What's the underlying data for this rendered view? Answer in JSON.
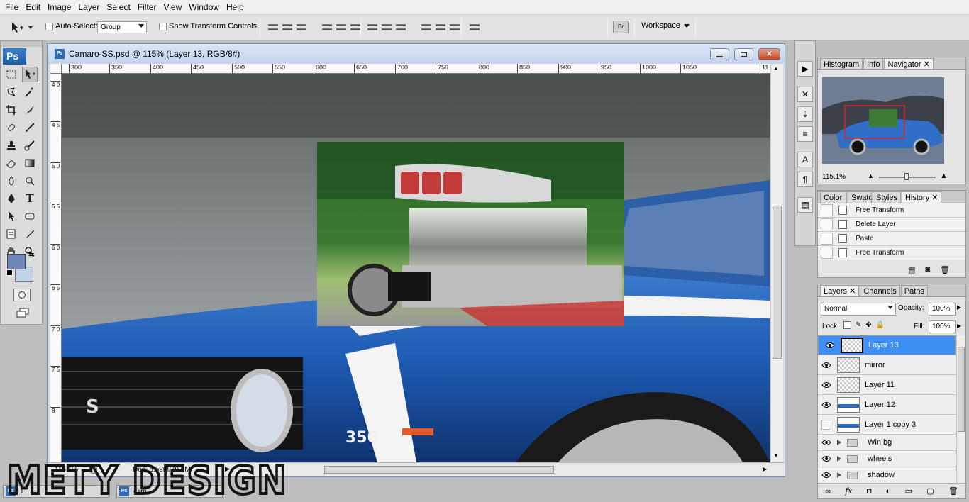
{
  "menubar": [
    "File",
    "Edit",
    "Image",
    "Layer",
    "Select",
    "Filter",
    "View",
    "Window",
    "Help"
  ],
  "options": {
    "auto_select_label": "Auto-Select:",
    "auto_select_value": "Group",
    "show_transform_label": "Show Transform Controls",
    "workspace_label": "Workspace"
  },
  "tools": {
    "badge": "Ps"
  },
  "document": {
    "title": "Camaro-SS.psd @ 115% (Layer 13, RGB/8#)",
    "ruler_top": [
      "300",
      "350",
      "400",
      "450",
      "500",
      "550",
      "600",
      "650",
      "700",
      "750",
      "800",
      "850",
      "900",
      "950",
      "1000",
      "1050",
      "11"
    ],
    "ruler_left": [
      "4 0",
      "4 5",
      "5 0",
      "5 5",
      "6 0",
      "6 5",
      "7 0",
      "7 5",
      "8"
    ],
    "zoom": "115.1%",
    "doc_size": "Doc: 6.59M/79.9M"
  },
  "navigator": {
    "tabs": [
      "Histogram",
      "Info",
      "Navigator"
    ],
    "zoom": "115.1%"
  },
  "history": {
    "tabs": [
      "Color",
      "Swatc",
      "Styles",
      "History"
    ],
    "items": [
      "Free Transform",
      "Delete Layer",
      "Paste",
      "Free Transform"
    ]
  },
  "layers": {
    "tabs": [
      "Layers",
      "Channels",
      "Paths"
    ],
    "blend_mode": "Normal",
    "opacity_label": "Opacity:",
    "opacity_value": "100%",
    "lock_label": "Lock:",
    "fill_label": "Fill:",
    "fill_value": "100%",
    "items": [
      "Layer 13",
      "mirror",
      "Layer 11",
      "Layer 12",
      "Layer 1 copy 3"
    ],
    "groups": [
      "Win bg",
      "wheels",
      "shadow"
    ]
  },
  "watermark": {
    "text": "METY DESIGN"
  },
  "minimized_docs": [
    "1T...",
    "esm..."
  ],
  "colors": {
    "foreground": "#6f87b8",
    "background": "#bfd1e6",
    "selected_layer": "#3d8ef5"
  }
}
